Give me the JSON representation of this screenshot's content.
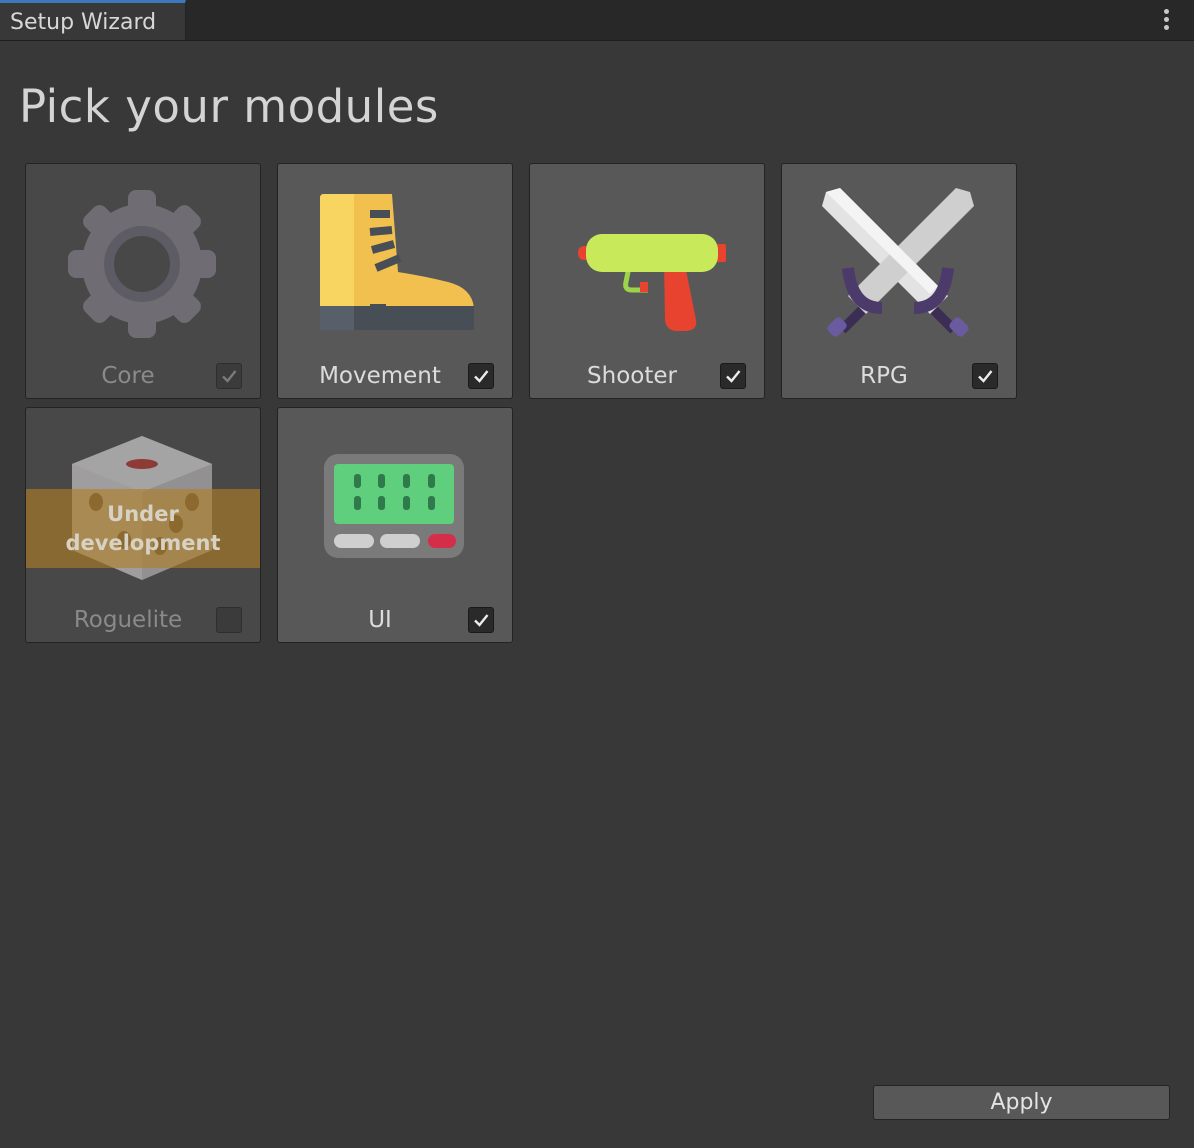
{
  "window": {
    "tab_title": "Setup Wizard",
    "menu_icon": "kebab-menu-icon"
  },
  "heading": "Pick your modules",
  "modules": [
    {
      "label": "Core",
      "icon": "gear-icon",
      "checked": true,
      "enabled": false
    },
    {
      "label": "Movement",
      "icon": "boot-icon",
      "checked": true,
      "enabled": true
    },
    {
      "label": "Shooter",
      "icon": "water-gun-icon",
      "checked": true,
      "enabled": true
    },
    {
      "label": "RPG",
      "icon": "crossed-swords-icon",
      "checked": true,
      "enabled": true
    },
    {
      "label": "Roguelite",
      "icon": "dice-icon",
      "checked": false,
      "enabled": false,
      "banner": "Under development"
    },
    {
      "label": "UI",
      "icon": "pager-icon",
      "checked": true,
      "enabled": true
    }
  ],
  "apply_label": "Apply",
  "colors": {
    "window_bg": "#383838",
    "card_bg": "#585858",
    "tab_accent": "#3a79bb",
    "banner": "#b07e24"
  }
}
